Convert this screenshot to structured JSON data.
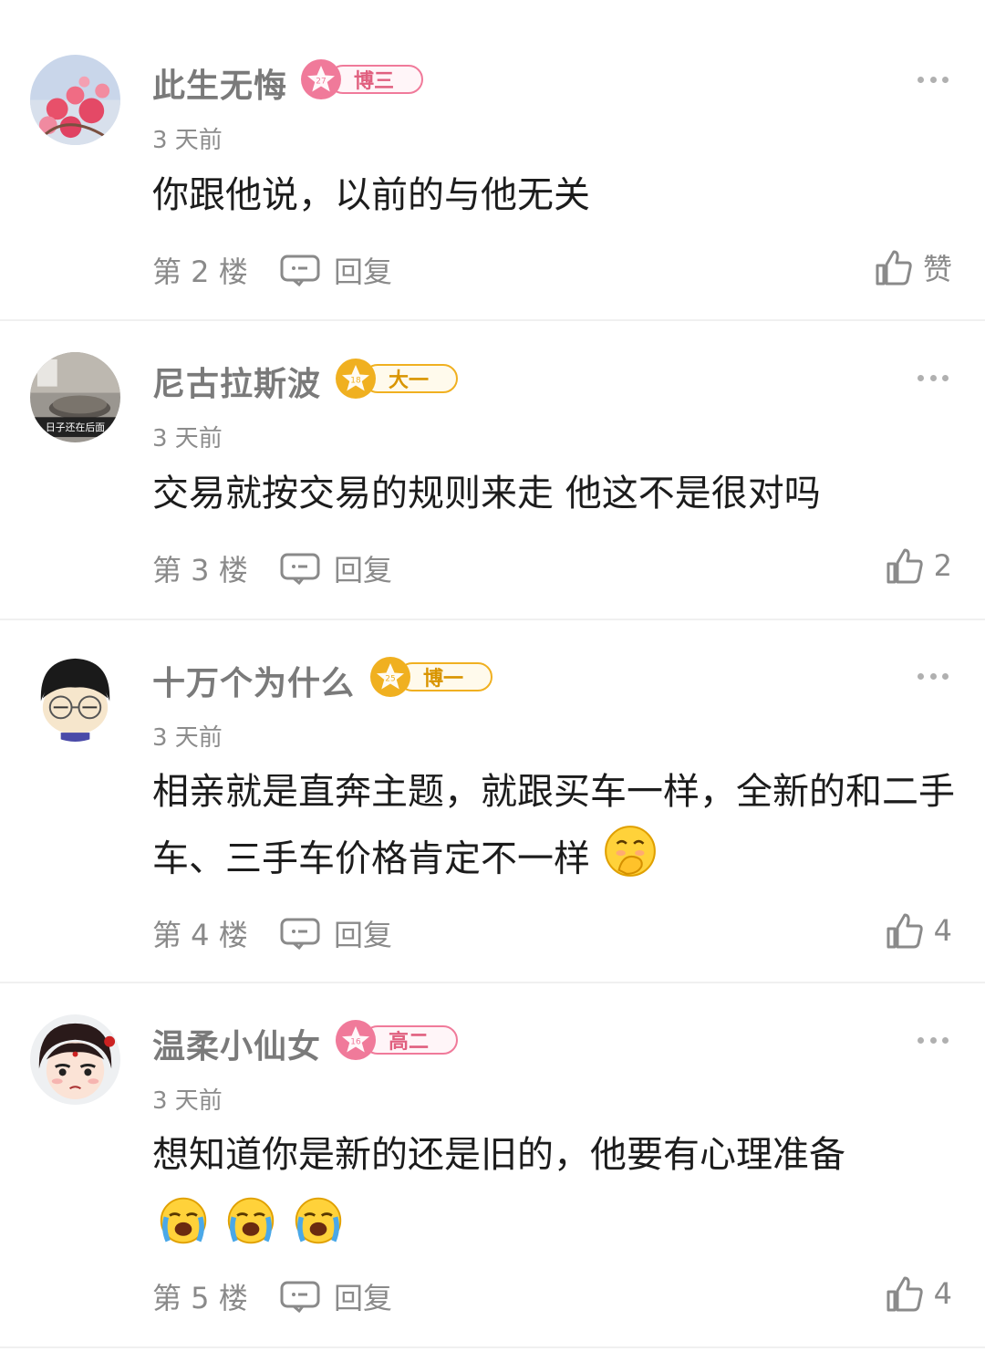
{
  "comments": [
    {
      "username": "此生无悔",
      "badge": {
        "level": "27",
        "title": "博三",
        "color": "pink"
      },
      "time": "3 天前",
      "content": "你跟他说，以前的与他无关",
      "floor": "第 2 楼",
      "reply_label": "回复",
      "like_label": "赞"
    },
    {
      "username": "尼古拉斯波",
      "badge": {
        "level": "18",
        "title": "大一",
        "color": "gold"
      },
      "time": "3 天前",
      "content": "交易就按交易的规则来走 他这不是很对吗",
      "floor": "第 3 楼",
      "reply_label": "回复",
      "like_label": "2",
      "avatar_caption": "日子还在后面"
    },
    {
      "username": "十万个为什么",
      "badge": {
        "level": "25",
        "title": "博一",
        "color": "gold"
      },
      "time": "3 天前",
      "content": "相亲就是直奔主题，就跟买车一样，全新的和二手车、三手车价格肯定不一样",
      "floor": "第 4 楼",
      "reply_label": "回复",
      "like_label": "4"
    },
    {
      "username": "温柔小仙女",
      "badge": {
        "level": "16",
        "title": "高二",
        "color": "pink"
      },
      "time": "3 天前",
      "content": "想知道你是新的还是旧的，他要有心理准备",
      "floor": "第 5 楼",
      "reply_label": "回复",
      "like_label": "4"
    }
  ],
  "icons": {
    "more": "more-icon",
    "reply": "comment-bubble-icon",
    "like": "thumbs-up-icon",
    "emoji_covering_mouth": "face-with-hand-over-mouth-emoji",
    "emoji_crying": "loudly-crying-face-emoji"
  },
  "colors": {
    "badge_pink": "#f07a9a",
    "badge_gold": "#f0b020",
    "secondary_text": "#8a8a8a"
  }
}
